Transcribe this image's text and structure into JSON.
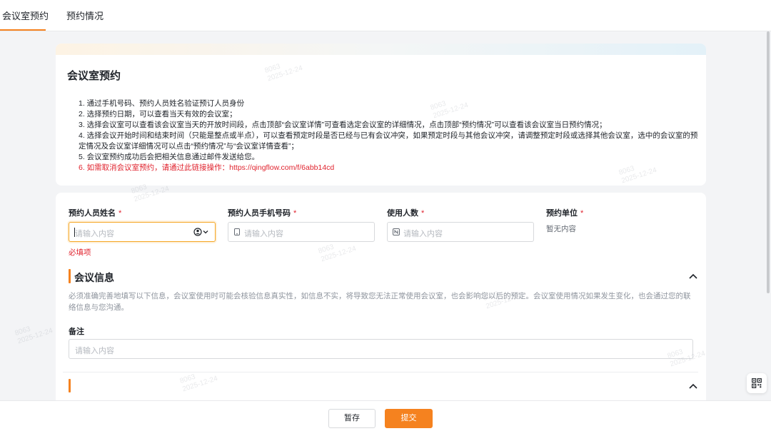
{
  "tabs": [
    {
      "label": "会议室预约",
      "active": true
    },
    {
      "label": "预约情况",
      "active": false
    }
  ],
  "intro": {
    "title": "会议室预约",
    "items": [
      "1. 通过手机号码、预约人员姓名验证预订人员身份",
      "2. 选择预约日期，可以查看当天有效的会议室；",
      "3. 选择会议室可以查看该会议室当天的开放时间段，点击顶部“会议室详情”可查看选定会议室的详细情况，点击顶部“预约情况”可以查看该会议室当日预约情况；",
      "4. 选择会议开始时间和结束时间（只能是整点或半点），可以查看预定时段是否已经与已有会议冲突，如果预定时段与其他会议冲突，请调整预定时段或选择其他会议室，选中的会议室的预定情况及会议室详细情况可以点击“预约情况”与“会议室详情查看”；",
      "5. 会议室预约成功后会把相关信息通过邮件发送给您。",
      "6. 如需取消会议室预约，请通过此链接操作：https://qingflow.com/f/6abb14cd"
    ]
  },
  "form": {
    "name_label": "预约人员姓名",
    "phone_label": "预约人员手机号码",
    "count_label": "使用人数",
    "unit_label": "预约单位",
    "required_mark": "*",
    "placeholder": "请输入内容",
    "required_error": "必填项",
    "unit_value": "暂无内容"
  },
  "meeting_section": {
    "title": "会议信息",
    "description": "必须准确完善地填写以下信息，会议室使用时可能会核验信息真实性，如信息不实，将导致您无法正常使用会议室，也会影响您以后的预定。会议室使用情况如果发生变化，也会通过您的联络信息与您沟通。",
    "remark_label": "备注",
    "remark_placeholder": "请输入内容"
  },
  "footer": {
    "save_label": "暂存",
    "submit_label": "提交"
  },
  "watermark": {
    "line1": "8063",
    "line2": "2025-12-24"
  },
  "colors": {
    "accent": "#f5821f",
    "error": "#e0232e"
  },
  "icons": {
    "phone_field": "phone-icon",
    "count_field": "number-icon",
    "name_field": "person-select-icon",
    "collapse": "chevron-up-icon",
    "qr": "qr-code-icon"
  }
}
